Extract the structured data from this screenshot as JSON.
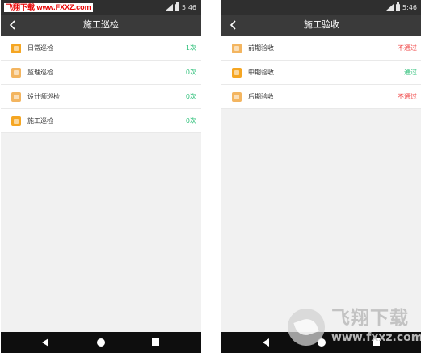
{
  "watermark": "飞翔下载 www.FXXZ.com",
  "status": {
    "time": "5:46"
  },
  "colors": {
    "icon_orange": "#f5a623",
    "icon_tan": "#f3b560",
    "status_green": "#2ec07a",
    "status_red": "#f04848"
  },
  "left_screen": {
    "title": "施工巡检",
    "back_icon": "chevron-left-icon",
    "items": [
      {
        "label": "日常巡检",
        "value": "1次",
        "icon": "checklist-icon"
      },
      {
        "label": "监理巡检",
        "value": "0次",
        "icon": "document-icon"
      },
      {
        "label": "设计师巡检",
        "value": "0次",
        "icon": "document-icon"
      },
      {
        "label": "施工巡检",
        "value": "0次",
        "icon": "checklist-icon"
      }
    ]
  },
  "right_screen": {
    "title": "施工验收",
    "back_icon": "chevron-left-icon",
    "items": [
      {
        "label": "前期验收",
        "value": "不通过",
        "status": "fail",
        "icon": "document-icon"
      },
      {
        "label": "中期验收",
        "value": "通过",
        "status": "pass",
        "icon": "checklist-icon"
      },
      {
        "label": "后期验收",
        "value": "不通过",
        "status": "fail",
        "icon": "document-icon"
      }
    ]
  },
  "nav": {
    "back_icon": "triangle-back-icon",
    "home_icon": "circle-home-icon",
    "recent_icon": "square-recent-icon"
  },
  "brand": {
    "title": "飞翔下载",
    "url": "www.fxxz.com"
  }
}
